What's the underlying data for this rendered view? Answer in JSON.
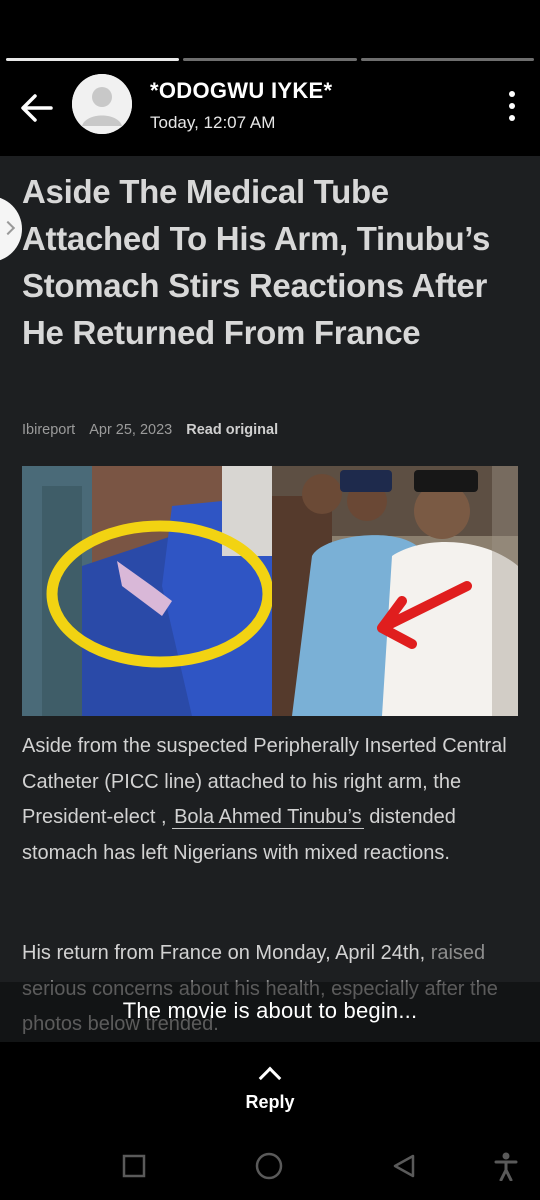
{
  "header": {
    "contact_name": "*ODOGWU IYKE*",
    "timestamp": "Today, 12:07 AM",
    "back_icon": "arrow-left-icon",
    "menu_icon": "more-vertical-icon"
  },
  "progress": {
    "segments": 3,
    "active_index": 0
  },
  "article": {
    "headline": "Aside The Medical Tube Attached To His Arm, Tinubu’s Stomach Stirs Reactions After He Returned From France",
    "source": "Ibireport",
    "date": "Apr 25, 2023",
    "read_original": "Read original",
    "para1_before": "Aside from the suspected Peripherally Inserted Central Catheter (PICC line) attached to his right arm, the President-elect ,",
    "para1_link": "Bola Ahmed Tinubu’s",
    "para1_after": "distended stomach has left Nigerians with mixed reactions.",
    "para2_visible": "His return from France on Monday, April 24th,",
    "para2_faded": "raised serious concerns about his health, especially after the photos below trended."
  },
  "caption": "The movie is about to begin...",
  "reply": {
    "label": "Reply"
  },
  "colors": {
    "background": "#000000",
    "article_bg": "#1d1f21",
    "highlight_circle": "#f2d312",
    "arrow": "#e01e1e"
  }
}
